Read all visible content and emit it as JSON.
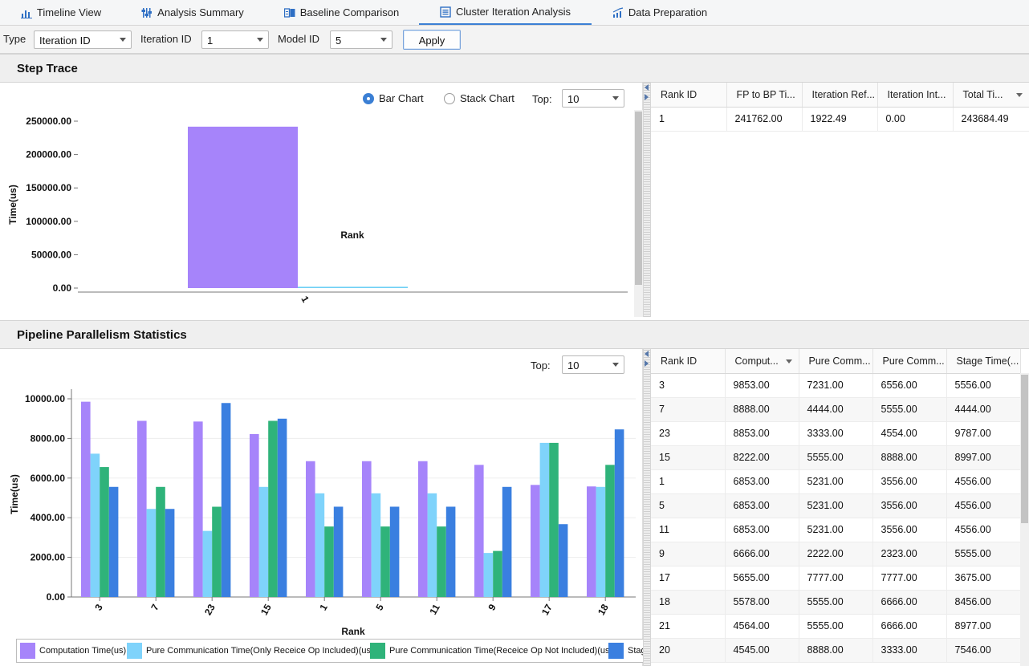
{
  "tabs": [
    {
      "label": "Timeline View",
      "icon": "bar-chart-icon"
    },
    {
      "label": "Analysis Summary",
      "icon": "sliders-icon"
    },
    {
      "label": "Baseline Comparison",
      "icon": "compare-icon"
    },
    {
      "label": "Cluster Iteration Analysis",
      "icon": "document-icon",
      "active": true
    },
    {
      "label": "Data Preparation",
      "icon": "trend-chart-icon"
    }
  ],
  "filters": {
    "type_label": "Type",
    "type_value": "Iteration ID",
    "iteration_label": "Iteration ID",
    "iteration_value": "1",
    "model_label": "Model ID",
    "model_value": "5",
    "apply_label": "Apply"
  },
  "step_trace": {
    "title": "Step Trace",
    "radio_bar": "Bar Chart",
    "radio_stack": "Stack Chart",
    "top_label": "Top:",
    "top_value": "10",
    "table": {
      "columns": [
        "Rank ID",
        "FP to BP Ti...",
        "Iteration Ref...",
        "Iteration Int...",
        "Total Ti..."
      ],
      "rows": [
        [
          "1",
          "241762.00",
          "1922.49",
          "0.00",
          "243684.49"
        ]
      ]
    }
  },
  "pipeline": {
    "title": "Pipeline Parallelism Statistics",
    "top_label": "Top:",
    "top_value": "10",
    "table": {
      "columns": [
        "Rank ID",
        "Comput...",
        "Pure Comm...",
        "Pure Comm...",
        "Stage Time(..."
      ],
      "rows": [
        [
          "3",
          "9853.00",
          "7231.00",
          "6556.00",
          "5556.00"
        ],
        [
          "7",
          "8888.00",
          "4444.00",
          "5555.00",
          "4444.00"
        ],
        [
          "23",
          "8853.00",
          "3333.00",
          "4554.00",
          "9787.00"
        ],
        [
          "15",
          "8222.00",
          "5555.00",
          "8888.00",
          "8997.00"
        ],
        [
          "1",
          "6853.00",
          "5231.00",
          "3556.00",
          "4556.00"
        ],
        [
          "5",
          "6853.00",
          "5231.00",
          "3556.00",
          "4556.00"
        ],
        [
          "11",
          "6853.00",
          "5231.00",
          "3556.00",
          "4556.00"
        ],
        [
          "9",
          "6666.00",
          "2222.00",
          "2323.00",
          "5555.00"
        ],
        [
          "17",
          "5655.00",
          "7777.00",
          "7777.00",
          "3675.00"
        ],
        [
          "18",
          "5578.00",
          "5555.00",
          "6666.00",
          "8456.00"
        ],
        [
          "21",
          "4564.00",
          "5555.00",
          "6666.00",
          "8977.00"
        ],
        [
          "20",
          "4545.00",
          "8888.00",
          "3333.00",
          "7546.00"
        ]
      ]
    }
  },
  "chart_data": [
    {
      "type": "bar",
      "title": "",
      "xlabel": "Rank",
      "ylabel": "Time(us)",
      "categories": [
        "1"
      ],
      "ylim": [
        0,
        250000
      ],
      "yticks": [
        "0.00",
        "50000.00",
        "100000.00",
        "150000.00",
        "200000.00",
        "250000.00"
      ],
      "series": [
        {
          "values": [
            241762.0
          ]
        },
        {
          "values": [
            1922.49
          ]
        }
      ],
      "colors": [
        "#a684fa",
        "#6fd0f5"
      ]
    },
    {
      "type": "bar",
      "title": "",
      "xlabel": "Rank",
      "ylabel": "Time(us)",
      "categories": [
        "3",
        "7",
        "23",
        "15",
        "1",
        "5",
        "11",
        "9",
        "17",
        "18"
      ],
      "ylim": [
        0,
        10000
      ],
      "yticks": [
        "0.00",
        "2000.00",
        "4000.00",
        "6000.00",
        "8000.00",
        "10000.00"
      ],
      "grid": true,
      "legend_position": "bottom",
      "series": [
        {
          "name": "Computation Time(us)",
          "values": [
            9853,
            8888,
            8853,
            8222,
            6853,
            6853,
            6853,
            6666,
            5655,
            5578
          ]
        },
        {
          "name": "Pure Communication Time(Only Receice Op Included)(us)",
          "values": [
            7231,
            4444,
            3333,
            5555,
            5231,
            5231,
            5231,
            2222,
            7777,
            5555
          ]
        },
        {
          "name": "Pure Communication Time(Receice Op Not Included)(us)",
          "values": [
            6556,
            5555,
            4554,
            8888,
            3556,
            3556,
            3556,
            2323,
            7777,
            6666
          ]
        },
        {
          "name": "Stag",
          "values": [
            5556,
            4444,
            9787,
            8997,
            4556,
            4556,
            4556,
            5555,
            3675,
            8456
          ]
        }
      ],
      "colors": [
        "#a684fa",
        "#7fd3fb",
        "#2fb37a",
        "#3a7fe0"
      ]
    }
  ]
}
